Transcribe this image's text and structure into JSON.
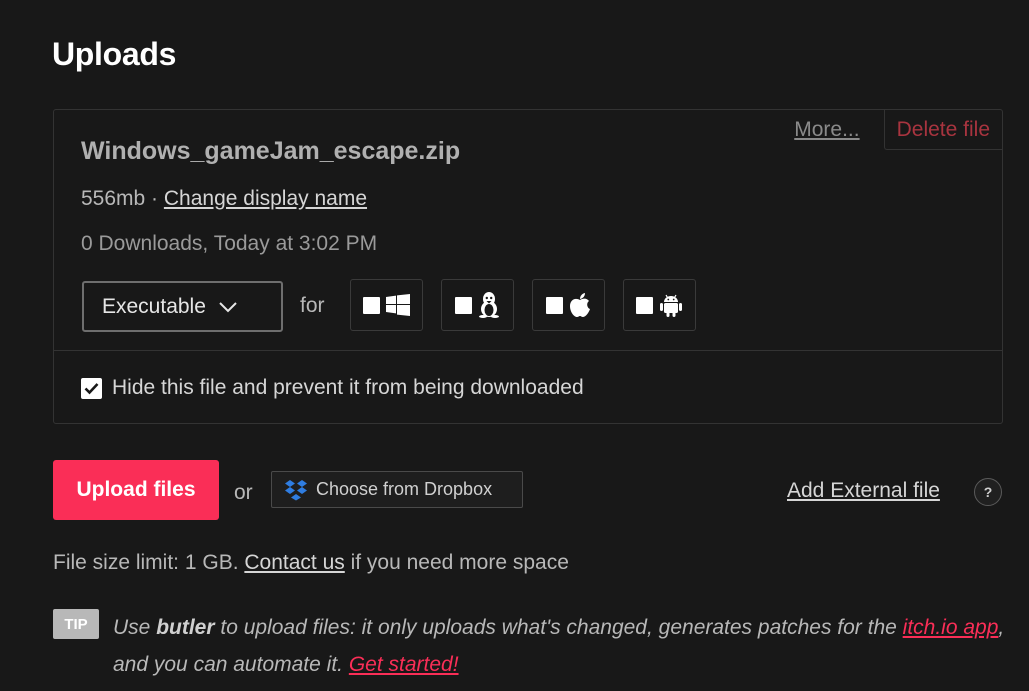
{
  "section": {
    "title": "Uploads"
  },
  "file": {
    "name": "Windows_gameJam_escape.zip",
    "size": "556mb",
    "separator": " · ",
    "change_name_label": "Change display name",
    "downloads_info": "0 Downloads, Today at 3:02 PM",
    "more_label": "More...",
    "delete_label": "Delete file",
    "type_selected": "Executable",
    "for_label": "for",
    "platforms": [
      {
        "name": "windows",
        "checked": false,
        "icon": "windows-icon"
      },
      {
        "name": "linux",
        "checked": false,
        "icon": "linux-icon"
      },
      {
        "name": "macos",
        "checked": false,
        "icon": "apple-icon"
      },
      {
        "name": "android",
        "checked": false,
        "icon": "android-icon"
      }
    ],
    "hide_label": "Hide this file and prevent it from being downloaded",
    "hide_checked": true
  },
  "actions": {
    "upload_label": "Upload files",
    "or_label": "or",
    "dropbox_label": "Choose from Dropbox",
    "external_label": "Add External file",
    "help_label": "?"
  },
  "limit": {
    "prefix": "File size limit: 1 GB. ",
    "contact_label": "Contact us",
    "suffix": " if you need more space"
  },
  "tip": {
    "badge": "TIP",
    "use": "Use ",
    "butler": "butler",
    "mid": " to upload files: it only uploads what's changed, generates patches for the ",
    "app_link": "itch.io app",
    "after_app": ", and you can automate it. ",
    "started_link": "Get started!"
  },
  "colors": {
    "accent": "#fa2e57",
    "background": "#181818",
    "delete": "#a8343f"
  }
}
